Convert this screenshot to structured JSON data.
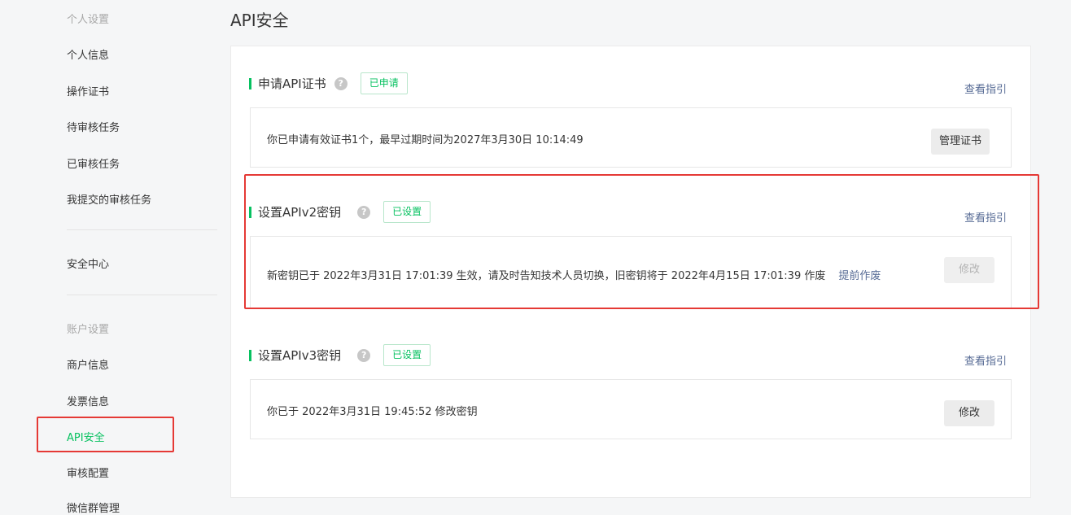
{
  "sidebar": {
    "group_personal": "个人设置",
    "items_personal": [
      "个人信息",
      "操作证书",
      "待审核任务",
      "已审核任务",
      "我提交的审核任务"
    ],
    "security_center": "安全中心",
    "group_account": "账户设置",
    "items_account": [
      "商户信息",
      "发票信息",
      "API安全",
      "审核配置",
      "微信群管理"
    ],
    "active_item": "API安全"
  },
  "page": {
    "title": "API安全"
  },
  "sections": [
    {
      "title": "申请API证书",
      "badge": "已申请",
      "guide_link": "查看指引",
      "description": "你已申请有效证书1个，最早过期时间为2027年3月30日 10:14:49",
      "button": "管理证书"
    },
    {
      "title": "设置APIv2密钥",
      "badge": "已设置",
      "guide_link": "查看指引",
      "description": "新密钥已于 2022年3月31日 17:01:39 生效，请及时告知技术人员切换，旧密钥将于 2022年4月15日 17:01:39 作废",
      "inline_link": "提前作废",
      "button": "修改",
      "button_disabled": true
    },
    {
      "title": "设置APIv3密钥",
      "badge": "已设置",
      "guide_link": "查看指引",
      "description": "你已于 2022年3月31日 19:45:52 修改密钥",
      "button": "修改"
    }
  ],
  "icons": {
    "help": "question-circle-icon"
  },
  "colors": {
    "accent": "#07c160",
    "link": "#576b95",
    "highlight": "#e53935"
  }
}
